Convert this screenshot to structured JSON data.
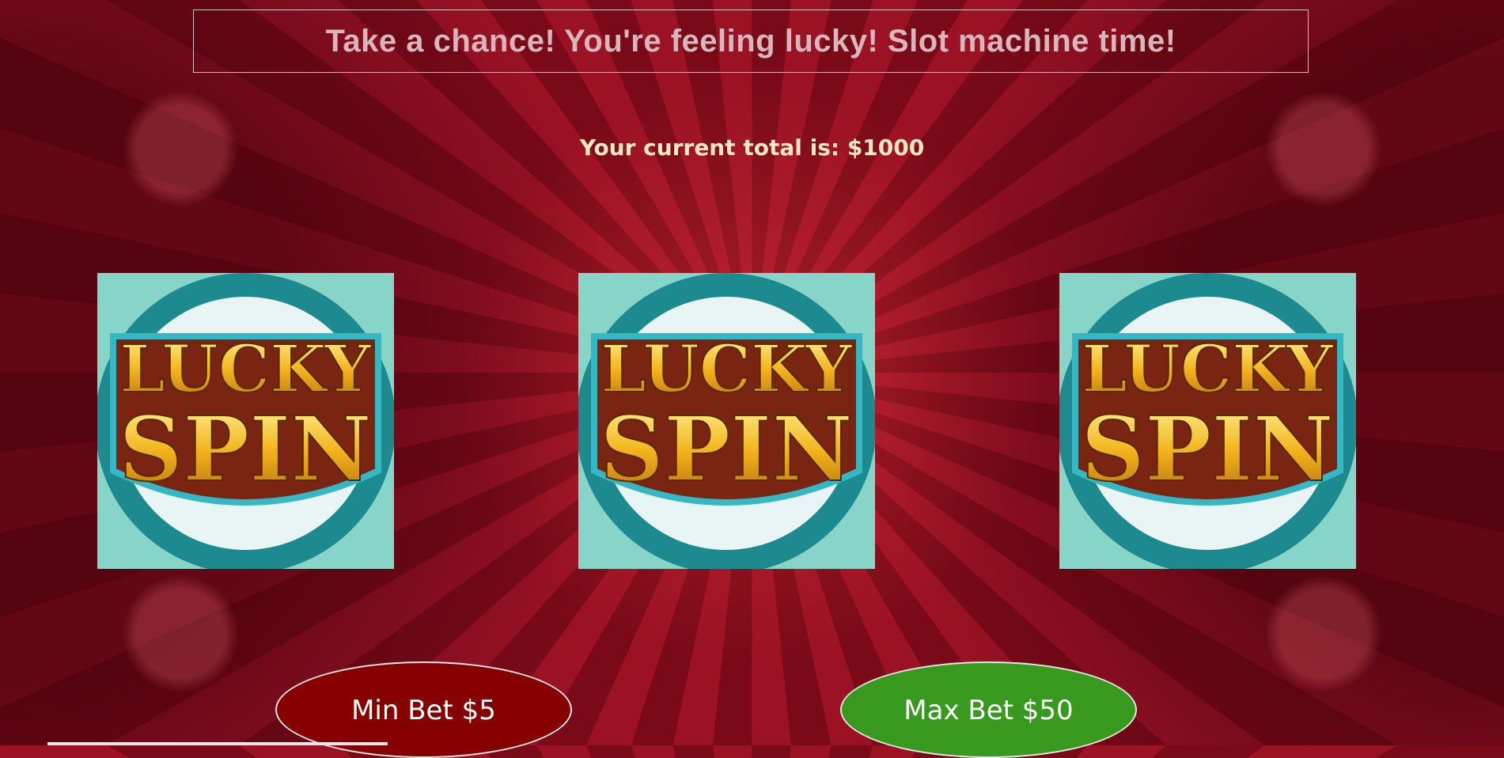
{
  "header": {
    "title": "Take a chance! You're feeling lucky! Slot machine time!"
  },
  "status": {
    "total_text": "Your current total is: $1000"
  },
  "reels": [
    {
      "icon": "lucky-spin-logo",
      "line1": "LUCKY",
      "line2": "SPIN"
    },
    {
      "icon": "lucky-spin-logo",
      "line1": "LUCKY",
      "line2": "SPIN"
    },
    {
      "icon": "lucky-spin-logo",
      "line1": "LUCKY",
      "line2": "SPIN"
    }
  ],
  "controls": {
    "min_bet_label": "Min Bet $5",
    "max_bet_label": "Max Bet $50"
  },
  "colors": {
    "min_bet_bg": "#870000",
    "max_bet_bg": "#38991f",
    "background": "#7a0a18"
  }
}
